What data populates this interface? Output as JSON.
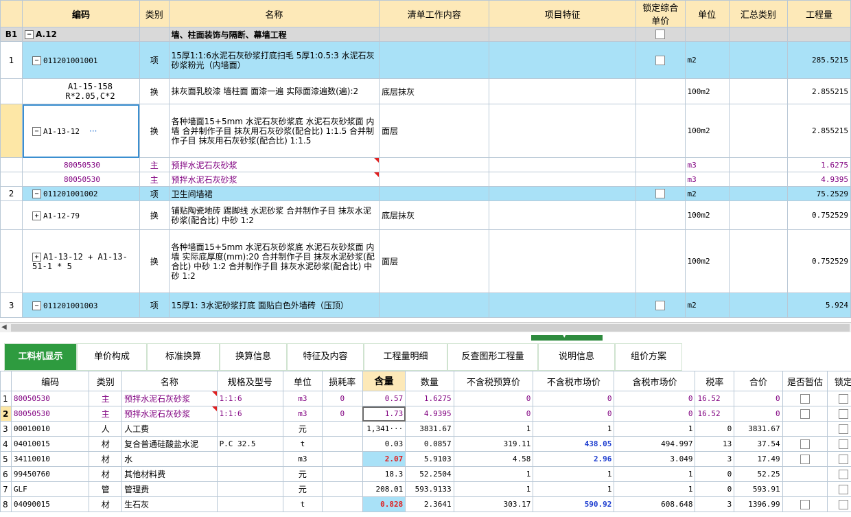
{
  "upper_headers": [
    "",
    "编码",
    "类别",
    "名称",
    "清单工作内容",
    "项目特征",
    "锁定综合单价",
    "单位",
    "汇总类别",
    "工程量"
  ],
  "rows": {
    "r0": {
      "num": "B1",
      "code": "A.12",
      "cat": "",
      "name": "墙、柱面装饰与隔断、幕墙工程",
      "content": "",
      "feature": "",
      "unit": "",
      "sum": "",
      "qty": ""
    },
    "r1": {
      "num": "1",
      "code": "011201001001",
      "cat": "项",
      "name": "15厚1:1:6水泥石灰砂浆打底扫毛 5厚1:0.5:3 水泥石灰砂浆粉光（内墙面）",
      "content": "",
      "feature": "",
      "unit": "m2",
      "sum": "",
      "qty": "285.5215"
    },
    "r2": {
      "num": "",
      "code": "A1-15-158 R*2.05,C*2",
      "cat": "换",
      "name": "抹灰面乳胶漆 墙柱面 面漆一遍  实际面漆遍数(遍):2",
      "content": "底层抹灰",
      "feature": "",
      "unit": "100m2",
      "sum": "",
      "qty": "2.855215"
    },
    "r3": {
      "num": "",
      "code": "A1-13-12",
      "dots": "···",
      "cat": "换",
      "name": "各种墙面15+5mm 水泥石灰砂浆底 水泥石灰砂浆面 内墙  合并制作子目 抹灰用石灰砂浆(配合比) 1:1.5  合并制作子目 抹灰用石灰砂浆(配合比) 1:1.5",
      "content": "面层",
      "feature": "",
      "unit": "100m2",
      "sum": "",
      "qty": "2.855215"
    },
    "r4": {
      "num": "",
      "code": "80050530",
      "cat": "主",
      "name": "预拌水泥石灰砂浆",
      "content": "",
      "feature": "",
      "unit": "m3",
      "sum": "",
      "qty": "1.6275"
    },
    "r5": {
      "num": "",
      "code": "80050530",
      "cat": "主",
      "name": "预拌水泥石灰砂浆",
      "content": "",
      "feature": "",
      "unit": "m3",
      "sum": "",
      "qty": "4.9395"
    },
    "r6": {
      "num": "2",
      "code": "011201001002",
      "cat": "项",
      "name": "卫生间墙裙",
      "content": "",
      "feature": "",
      "unit": "m2",
      "sum": "",
      "qty": "75.2529"
    },
    "r7": {
      "num": "",
      "code": "A1-12-79",
      "cat": "换",
      "name": "铺贴陶瓷地砖 踢脚线 水泥砂浆  合并制作子目 抹灰水泥砂浆(配合比) 中砂 1:2",
      "content": "底层抹灰",
      "feature": "",
      "unit": "100m2",
      "sum": "",
      "qty": "0.752529"
    },
    "r8": {
      "num": "",
      "code": "A1-13-12 + A1-13-51-1 * 5",
      "cat": "换",
      "name": "各种墙面15+5mm 水泥石灰砂浆底 水泥石灰砂浆面 内墙  实际底厚度(mm):20  合并制作子目 抹灰水泥砂浆(配合比) 中砂 1:2  合并制作子目 抹灰水泥砂浆(配合比) 中砂 1:2",
      "content": "面层",
      "feature": "",
      "unit": "100m2",
      "sum": "",
      "qty": "0.752529"
    },
    "r9": {
      "num": "3",
      "code": "011201001003",
      "cat": "项",
      "name": "15厚1: 3水泥砂浆打底 面贴白色外墙砖（压顶）",
      "content": "",
      "feature": "",
      "unit": "m2",
      "sum": "",
      "qty": "5.924"
    }
  },
  "tabs": [
    "工料机显示",
    "单价构成",
    "标准换算",
    "换算信息",
    "特征及内容",
    "工程量明细",
    "反查图形工程量",
    "说明信息",
    "组价方案"
  ],
  "lower_headers": [
    "",
    "编码",
    "类别",
    "名称",
    "规格及型号",
    "单位",
    "损耗率",
    "含量",
    "数量",
    "不含税预算价",
    "不含税市场价",
    "含税市场价",
    "税率",
    "合价",
    "是否暂估",
    "锁定"
  ],
  "lower_rows": [
    {
      "n": "1",
      "code": "80050530",
      "cat": "主",
      "name": "预拌水泥石灰砂浆",
      "spec": "1:1:6",
      "unit": "m3",
      "loss": "0",
      "content": "0.57",
      "qty": "1.6275",
      "budget": "0",
      "market": "0",
      "taxmarket": "0",
      "rate": "16.52",
      "total": "0"
    },
    {
      "n": "2",
      "code": "80050530",
      "cat": "主",
      "name": "预拌水泥石灰砂浆",
      "spec": "1:1:6",
      "unit": "m3",
      "loss": "0",
      "content": "1.73",
      "qty": "4.9395",
      "budget": "0",
      "market": "0",
      "taxmarket": "0",
      "rate": "16.52",
      "total": "0"
    },
    {
      "n": "3",
      "code": "00010010",
      "cat": "人",
      "name": "人工费",
      "spec": "",
      "unit": "元",
      "loss": "",
      "content": "1,341···",
      "qty": "3831.67",
      "budget": "1",
      "market": "1",
      "taxmarket": "1",
      "rate": "0",
      "total": "3831.67"
    },
    {
      "n": "4",
      "code": "04010015",
      "cat": "材",
      "name": "复合普通硅酸盐水泥",
      "spec": "P.C 32.5",
      "unit": "t",
      "loss": "",
      "content": "0.03",
      "qty": "0.0857",
      "budget": "319.11",
      "market": "438.05",
      "taxmarket": "494.997",
      "rate": "13",
      "total": "37.54"
    },
    {
      "n": "5",
      "code": "34110010",
      "cat": "材",
      "name": "水",
      "spec": "",
      "unit": "m3",
      "loss": "",
      "content": "2.07",
      "qty": "5.9103",
      "budget": "4.58",
      "market": "2.96",
      "taxmarket": "3.049",
      "rate": "3",
      "total": "17.49"
    },
    {
      "n": "6",
      "code": "99450760",
      "cat": "材",
      "name": "其他材料费",
      "spec": "",
      "unit": "元",
      "loss": "",
      "content": "18.3",
      "qty": "52.2504",
      "budget": "1",
      "market": "1",
      "taxmarket": "1",
      "rate": "0",
      "total": "52.25"
    },
    {
      "n": "7",
      "code": "GLF",
      "cat": "管",
      "name": "管理费",
      "spec": "",
      "unit": "元",
      "loss": "",
      "content": "208.01",
      "qty": "593.9133",
      "budget": "1",
      "market": "1",
      "taxmarket": "1",
      "rate": "0",
      "total": "593.91"
    },
    {
      "n": "8",
      "code": "04090015",
      "cat": "材",
      "name": "生石灰",
      "spec": "",
      "unit": "t",
      "loss": "",
      "content": "0.828",
      "qty": "2.3641",
      "budget": "303.17",
      "market": "590.92",
      "taxmarket": "608.648",
      "rate": "3",
      "total": "1396.99"
    }
  ],
  "colors": {
    "accent": "#2e9b3f",
    "item_row": "#a9e1f7",
    "group_row": "#d9d9d9",
    "header": "#fde9b8",
    "material_text": "#800080",
    "highlight_text": "#1f3fd0"
  }
}
